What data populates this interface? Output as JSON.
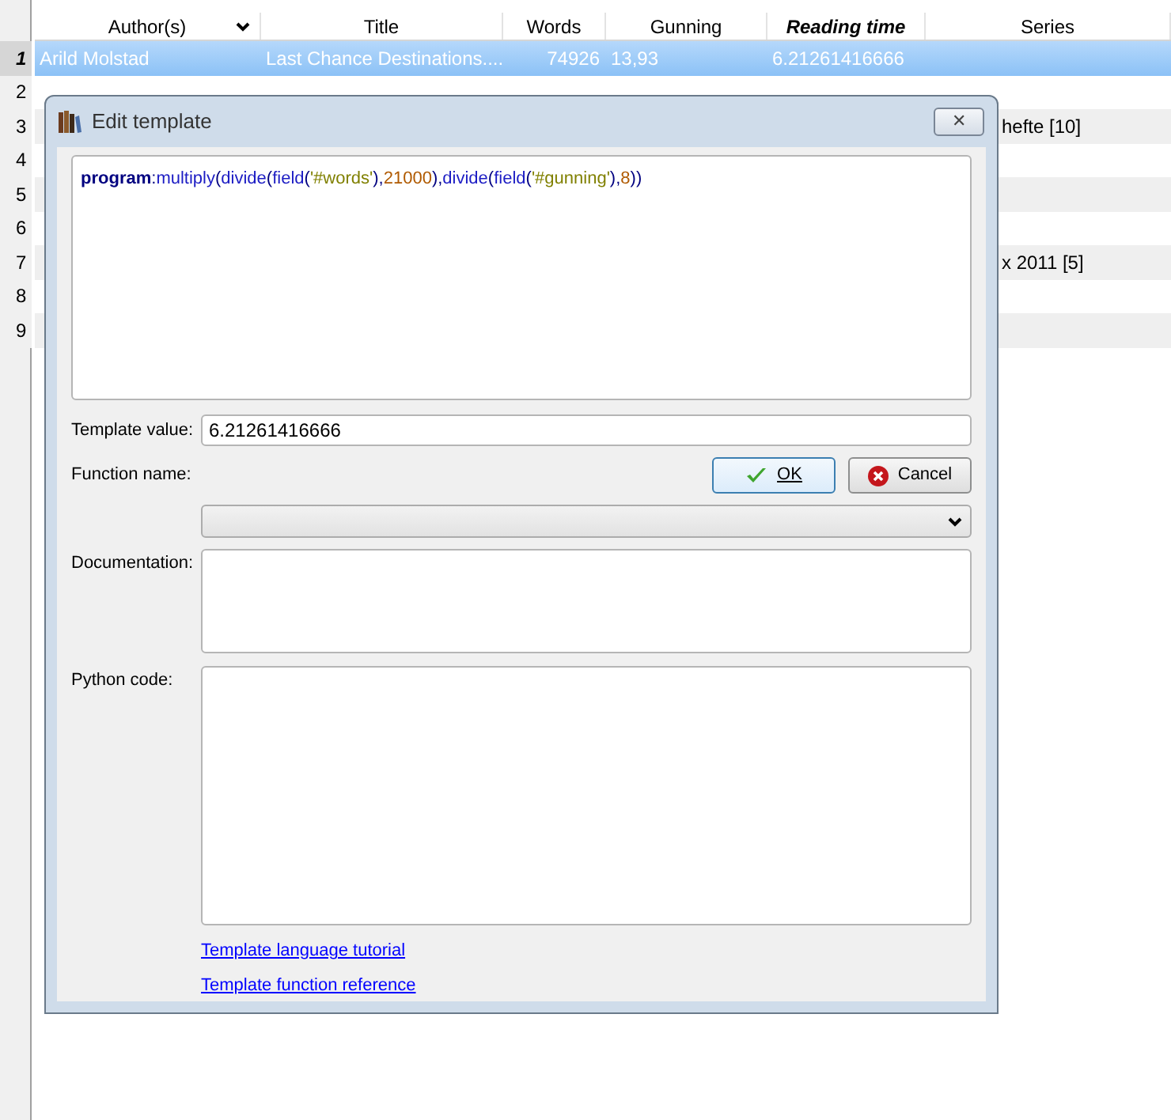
{
  "table": {
    "columns": [
      {
        "label": "Author(s)",
        "sorted": true,
        "emphasized": false
      },
      {
        "label": "Title",
        "sorted": false,
        "emphasized": false
      },
      {
        "label": "Words",
        "sorted": false,
        "emphasized": false
      },
      {
        "label": "Gunning",
        "sorted": false,
        "emphasized": false
      },
      {
        "label": "Reading time",
        "sorted": false,
        "emphasized": true
      },
      {
        "label": "Series",
        "sorted": false,
        "emphasized": false
      }
    ],
    "rows": [
      {
        "number": "1",
        "selected": true,
        "cells": {
          "author": "Arild Molstad",
          "title": "Last Chance Destinations....",
          "words": "74926",
          "gunning": "13,93",
          "reading_time": "6.21261416666"
        }
      },
      {
        "number": "2",
        "selected": false,
        "cells": {}
      },
      {
        "number": "3",
        "selected": false,
        "cells": {
          "series": "hefte [10]"
        }
      },
      {
        "number": "4",
        "selected": false,
        "cells": {}
      },
      {
        "number": "5",
        "selected": false,
        "cells": {}
      },
      {
        "number": "6",
        "selected": false,
        "cells": {}
      },
      {
        "number": "7",
        "selected": false,
        "cells": {
          "series": "x 2011 [5]"
        }
      },
      {
        "number": "8",
        "selected": false,
        "cells": {}
      },
      {
        "number": "9",
        "selected": false,
        "cells": {}
      }
    ]
  },
  "dialog": {
    "title": "Edit template",
    "close": "✕",
    "code": [
      {
        "text": "program",
        "kind": "keyword"
      },
      {
        "text": ":",
        "kind": "punct"
      },
      {
        "text": "multiply",
        "kind": "function"
      },
      {
        "text": "(",
        "kind": "punct"
      },
      {
        "text": "divide",
        "kind": "function"
      },
      {
        "text": "(",
        "kind": "punct"
      },
      {
        "text": "field",
        "kind": "function"
      },
      {
        "text": "(",
        "kind": "punct"
      },
      {
        "text": "'#words'",
        "kind": "string"
      },
      {
        "text": "),",
        "kind": "punct"
      },
      {
        "text": "21000",
        "kind": "number"
      },
      {
        "text": "),",
        "kind": "punct"
      },
      {
        "text": "divide",
        "kind": "function"
      },
      {
        "text": "(",
        "kind": "punct"
      },
      {
        "text": "field",
        "kind": "function"
      },
      {
        "text": "(",
        "kind": "punct"
      },
      {
        "text": "'#gunning'",
        "kind": "string"
      },
      {
        "text": "),",
        "kind": "punct"
      },
      {
        "text": "8",
        "kind": "number"
      },
      {
        "text": "))",
        "kind": "punct"
      }
    ],
    "template_value_label": "Template value:",
    "template_value": "6.21261416666",
    "function_name_label": "Function name:",
    "ok_button": "OK",
    "cancel_button": "Cancel",
    "documentation_label": "Documentation:",
    "python_code_label": "Python code:",
    "links": [
      "Template language tutorial",
      "Template function reference"
    ]
  }
}
